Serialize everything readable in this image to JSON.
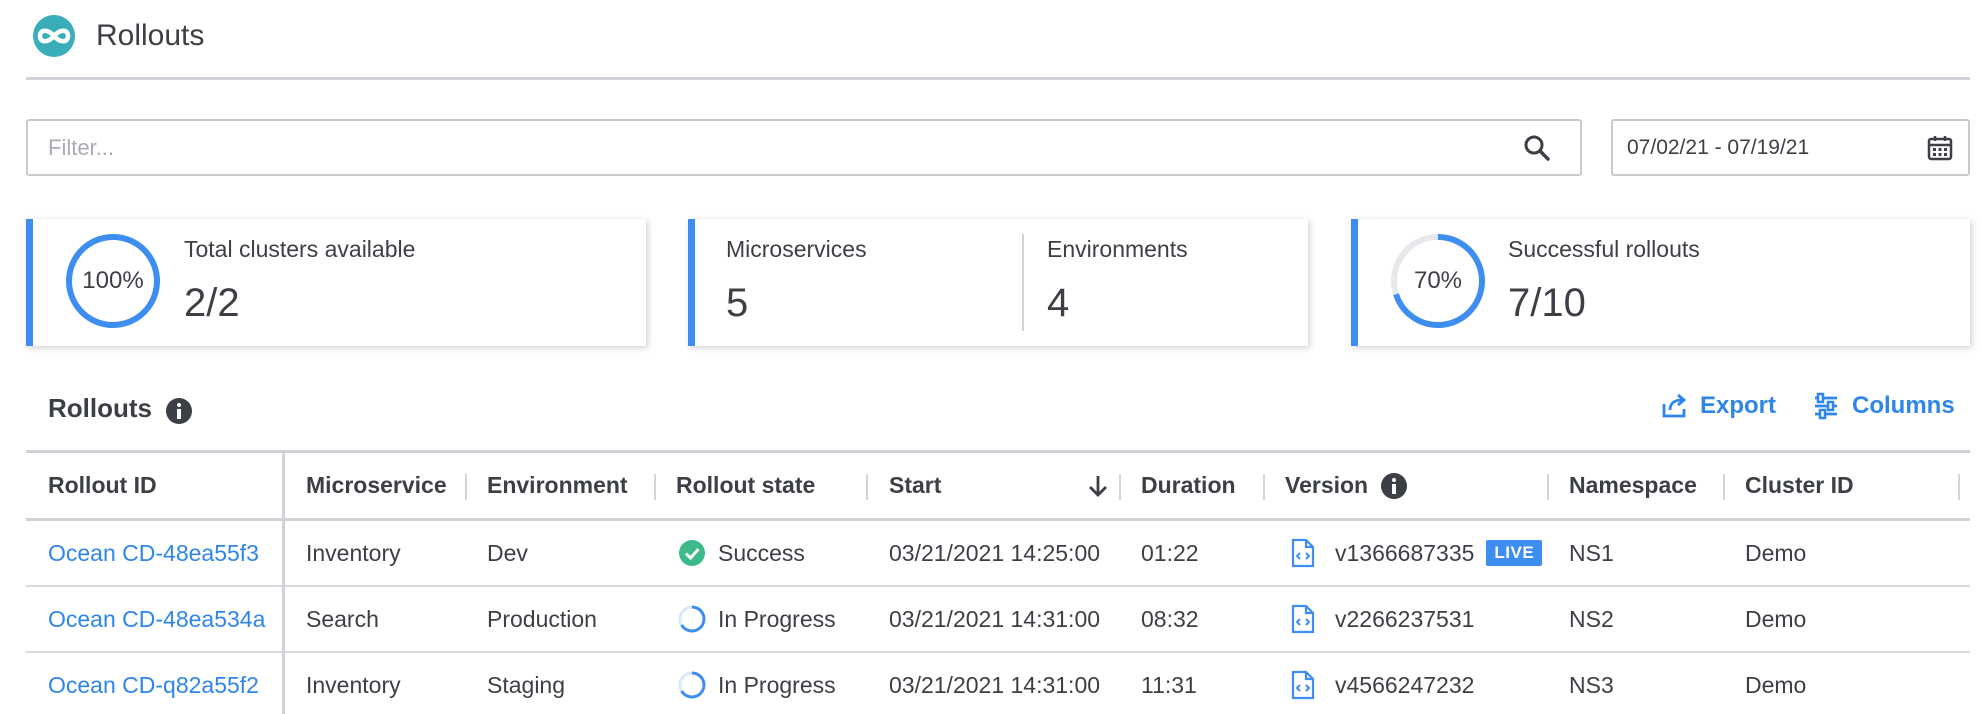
{
  "app": {
    "title": "Rollouts"
  },
  "filter": {
    "placeholder": "Filter...",
    "value": ""
  },
  "date_range": {
    "value": "07/02/21 - 07/19/21"
  },
  "kpis": {
    "clusters": {
      "percent_label": "100%",
      "percent": 100,
      "label": "Total clusters available",
      "value": "2/2"
    },
    "microservices": {
      "label": "Microservices",
      "value": "5"
    },
    "environments": {
      "label": "Environments",
      "value": "4"
    },
    "rollouts": {
      "percent_label": "70%",
      "percent": 70,
      "label": "Successful rollouts",
      "value": "7/10"
    }
  },
  "section": {
    "title": "Rollouts",
    "export_label": "Export",
    "columns_label": "Columns"
  },
  "table": {
    "columns": [
      "Rollout ID",
      "Microservice",
      "Environment",
      "Rollout state",
      "Start",
      "Duration",
      "Version",
      "Namespace",
      "Cluster ID"
    ],
    "sort": {
      "column": "Start",
      "direction": "descending"
    },
    "rows": [
      {
        "id": "Ocean CD-48ea55f3",
        "microservice": "Inventory",
        "environment": "Dev",
        "state": "Success",
        "state_icon": "check-circle-icon",
        "start": "03/21/2021 14:25:00",
        "duration": "01:22",
        "version": "v1366687335",
        "badge": "LIVE",
        "namespace": "NS1",
        "cluster": "Demo"
      },
      {
        "id": "Ocean CD-48ea534a",
        "microservice": "Search",
        "environment": "Production",
        "state": "In Progress",
        "state_icon": "spinner-icon",
        "start": "03/21/2021 14:31:00",
        "duration": "08:32",
        "version": "v2266237531",
        "badge": "",
        "namespace": "NS2",
        "cluster": "Demo"
      },
      {
        "id": "Ocean CD-q82a55f2",
        "microservice": "Inventory",
        "environment": "Staging",
        "state": "In Progress",
        "state_icon": "spinner-icon",
        "start": "03/21/2021 14:31:00",
        "duration": "11:31",
        "version": "v4566247232",
        "badge": "",
        "namespace": "NS3",
        "cluster": "Demo"
      }
    ]
  },
  "colors": {
    "accent": "#3d8ef0",
    "link": "#2f86ea",
    "success": "#3dba8a",
    "logo": "#3aaeb8",
    "border": "#cfd2d6"
  }
}
